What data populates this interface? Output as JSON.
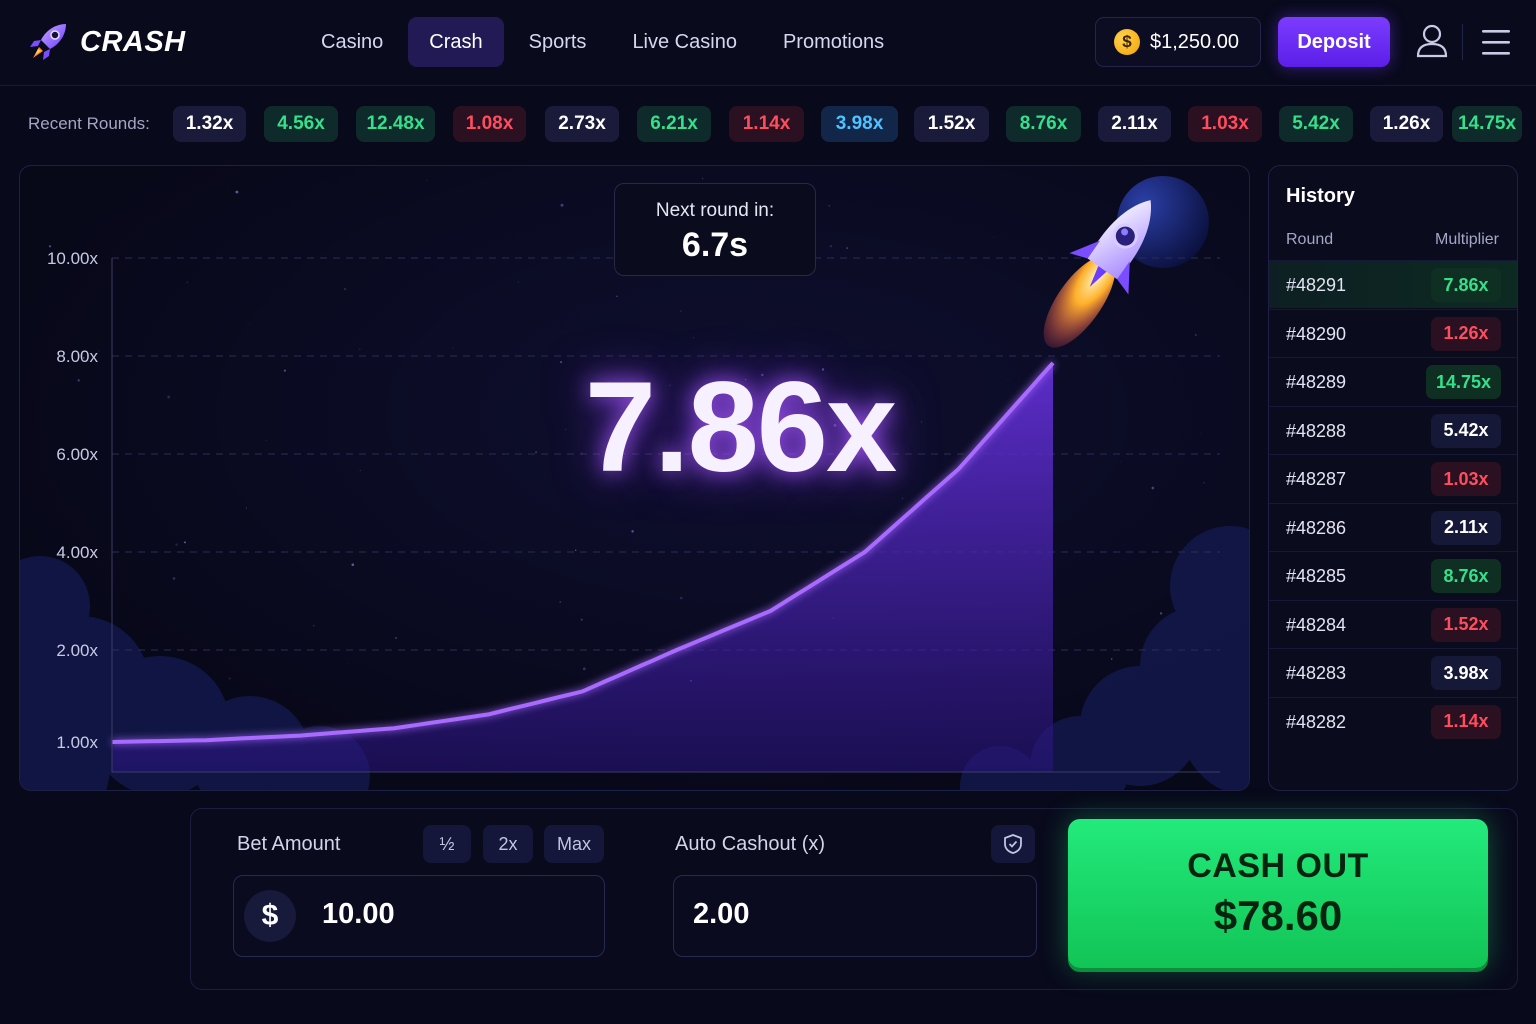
{
  "app": {
    "logo_text": "CRASH"
  },
  "nav": {
    "items": [
      {
        "label": "Casino",
        "active": false
      },
      {
        "label": "Crash",
        "active": true
      },
      {
        "label": "Sports",
        "active": false
      },
      {
        "label": "Live Casino",
        "active": false
      },
      {
        "label": "Promotions",
        "active": false
      }
    ]
  },
  "account": {
    "coin_symbol": "$",
    "balance": "$1,250.00",
    "deposit_label": "Deposit",
    "icons": [
      "user-icon",
      "menu-icon"
    ]
  },
  "recent": {
    "label": "Recent Rounds:",
    "rounds": [
      {
        "value": "1.32x",
        "tone": "white"
      },
      {
        "value": "4.56x",
        "tone": "green"
      },
      {
        "value": "12.48x",
        "tone": "green"
      },
      {
        "value": "1.08x",
        "tone": "red"
      },
      {
        "value": "2.73x",
        "tone": "white"
      },
      {
        "value": "6.21x",
        "tone": "green"
      },
      {
        "value": "1.14x",
        "tone": "red"
      },
      {
        "value": "3.98x",
        "tone": "cyan"
      },
      {
        "value": "1.52x",
        "tone": "white"
      },
      {
        "value": "8.76x",
        "tone": "green"
      },
      {
        "value": "2.11x",
        "tone": "white"
      },
      {
        "value": "1.03x",
        "tone": "red"
      },
      {
        "value": "5.42x",
        "tone": "green"
      },
      {
        "value": "1.26x",
        "tone": "white"
      },
      {
        "value": "14.75x",
        "tone": "green"
      }
    ]
  },
  "game": {
    "next_round_label": "Next round in:",
    "next_round_value": "6.7s",
    "current_multiplier": "7.86x",
    "colors": {
      "curve": "#a86bff",
      "fill": "#4a1fb8",
      "glow": "#8a4dff"
    }
  },
  "chart_data": {
    "type": "area",
    "y_ticks": [
      "10.00x",
      "8.00x",
      "6.00x",
      "4.00x",
      "2.00x",
      "1.00x"
    ],
    "y_tick_values": [
      10,
      8,
      6,
      4,
      2,
      1
    ],
    "ylim": [
      1,
      10
    ],
    "grid": true,
    "curve_end_value": 7.86,
    "series": [
      {
        "x": [
          0,
          0.1,
          0.2,
          0.3,
          0.4,
          0.5,
          0.6,
          0.7,
          0.8,
          0.9,
          1.0
        ],
        "values": [
          1.0,
          1.02,
          1.07,
          1.15,
          1.3,
          1.55,
          2.0,
          2.8,
          4.0,
          5.7,
          7.86
        ]
      }
    ]
  },
  "history": {
    "title": "History",
    "col_round": "Round",
    "col_multiplier": "Multiplier",
    "rows": [
      {
        "round": "#48291",
        "multiplier": "7.86x",
        "tone": "green",
        "current": true
      },
      {
        "round": "#48290",
        "multiplier": "1.26x",
        "tone": "red"
      },
      {
        "round": "#48289",
        "multiplier": "14.75x",
        "tone": "green"
      },
      {
        "round": "#48288",
        "multiplier": "5.42x",
        "tone": "white"
      },
      {
        "round": "#48287",
        "multiplier": "1.03x",
        "tone": "red"
      },
      {
        "round": "#48286",
        "multiplier": "2.11x",
        "tone": "white"
      },
      {
        "round": "#48285",
        "multiplier": "8.76x",
        "tone": "green"
      },
      {
        "round": "#48284",
        "multiplier": "1.52x",
        "tone": "red"
      },
      {
        "round": "#48283",
        "multiplier": "3.98x",
        "tone": "white"
      },
      {
        "round": "#48282",
        "multiplier": "1.14x",
        "tone": "red"
      }
    ]
  },
  "bet": {
    "label": "Bet Amount",
    "half_label": "½",
    "double_label": "2x",
    "max_label": "Max",
    "currency_symbol": "$",
    "value": "10.00"
  },
  "auto_cashout": {
    "label": "Auto Cashout (x)",
    "value": "2.00",
    "icon": "shield-icon"
  },
  "cashout": {
    "label": "CASH OUT",
    "amount": "$78.60"
  }
}
